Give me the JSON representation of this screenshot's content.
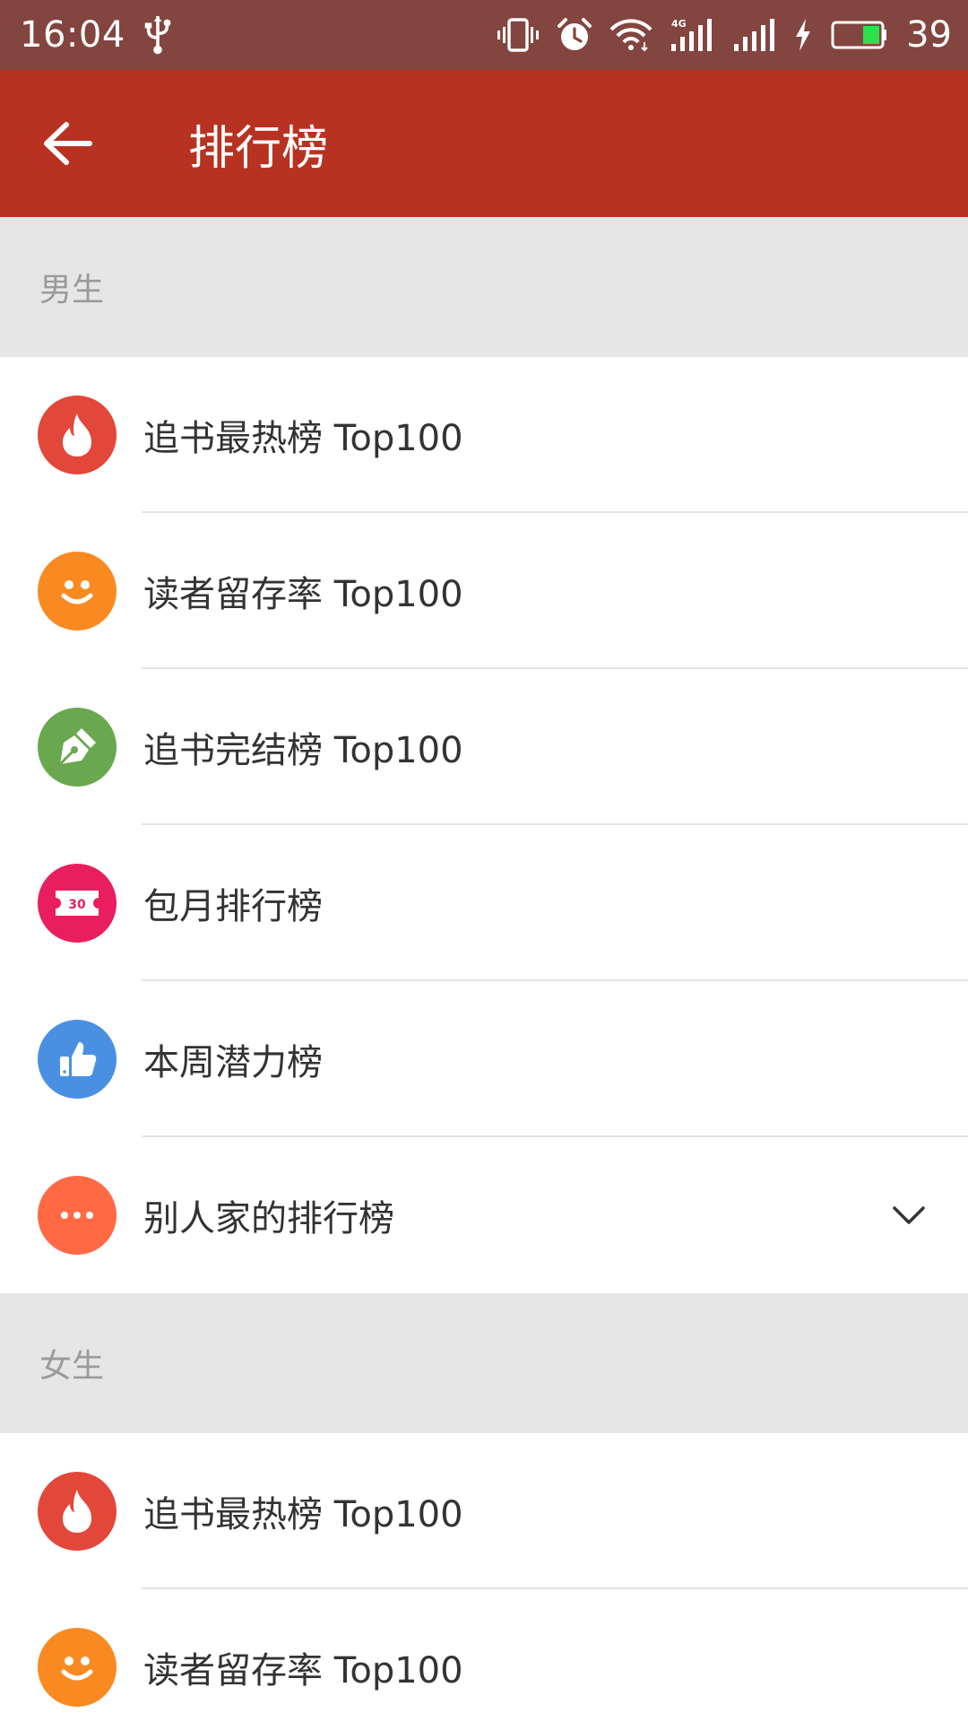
{
  "status_bar": {
    "time": "16:04",
    "battery_level": "39"
  },
  "app_bar": {
    "title": "排行榜"
  },
  "colors": {
    "status_bar": "#83453f",
    "app_bar": "#b83221",
    "section_bg": "#e6e6e6",
    "icon_red": "#e2473a",
    "icon_orange": "#f98a22",
    "icon_green": "#6aa84f",
    "icon_pink": "#e91e5e",
    "icon_blue": "#4a90e2",
    "icon_coral": "#ff6a45"
  },
  "sections": [
    {
      "title": "男生",
      "items": [
        {
          "label": "追书最热榜 Top100",
          "icon": "fire-icon"
        },
        {
          "label": "读者留存率 Top100",
          "icon": "smile-icon"
        },
        {
          "label": "追书完结榜 Top100",
          "icon": "pen-nib-icon"
        },
        {
          "label": "包月排行榜",
          "icon": "ticket-icon",
          "icon_text": "30"
        },
        {
          "label": "本周潜力榜",
          "icon": "thumbs-up-icon"
        },
        {
          "label": "别人家的排行榜",
          "icon": "more-icon",
          "expandable": true
        }
      ]
    },
    {
      "title": "女生",
      "items": [
        {
          "label": "追书最热榜 Top100",
          "icon": "fire-icon"
        },
        {
          "label": "读者留存率 Top100",
          "icon": "smile-icon"
        }
      ]
    }
  ]
}
